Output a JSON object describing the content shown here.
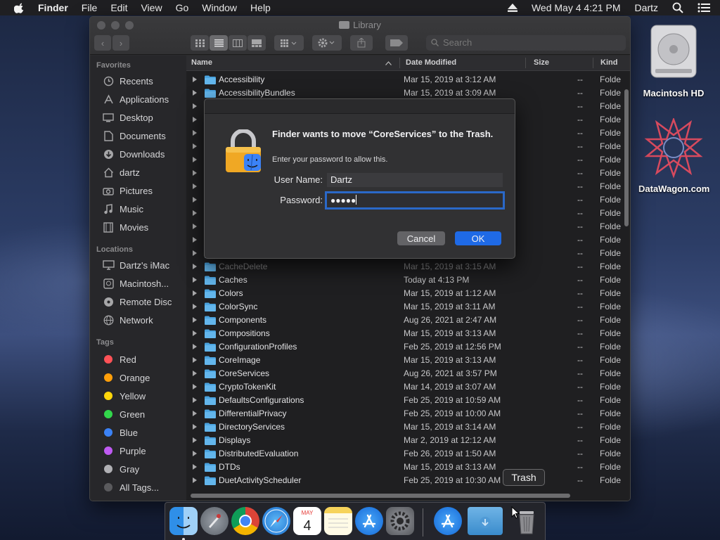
{
  "menubar": {
    "app": "Finder",
    "items": [
      "File",
      "Edit",
      "View",
      "Go",
      "Window",
      "Help"
    ],
    "datetime": "Wed May 4  4:21 PM",
    "user": "Dartz"
  },
  "desktop": {
    "icons": [
      {
        "label": "Macintosh HD",
        "icon": "hard-drive-icon"
      },
      {
        "label": "DataWagon.com",
        "icon": "star-emblem-icon"
      }
    ]
  },
  "window": {
    "title": "Library",
    "search_placeholder": "Search",
    "columns": {
      "name": "Name",
      "date": "Date Modified",
      "size": "Size",
      "kind": "Kind"
    },
    "sidebar": {
      "favorites_heading": "Favorites",
      "favorites": [
        {
          "label": "Recents",
          "icon": "clock-icon"
        },
        {
          "label": "Applications",
          "icon": "applications-icon"
        },
        {
          "label": "Desktop",
          "icon": "desktop-icon"
        },
        {
          "label": "Documents",
          "icon": "document-icon"
        },
        {
          "label": "Downloads",
          "icon": "download-icon"
        },
        {
          "label": "dartz",
          "icon": "home-icon"
        },
        {
          "label": "Pictures",
          "icon": "camera-icon"
        },
        {
          "label": "Music",
          "icon": "music-icon"
        },
        {
          "label": "Movies",
          "icon": "film-icon"
        }
      ],
      "locations_heading": "Locations",
      "locations": [
        {
          "label": "Dartz's iMac",
          "icon": "imac-icon"
        },
        {
          "label": "Macintosh...",
          "icon": "disk-icon"
        },
        {
          "label": "Remote Disc",
          "icon": "disc-icon"
        },
        {
          "label": "Network",
          "icon": "globe-icon"
        }
      ],
      "tags_heading": "Tags",
      "tags": [
        {
          "label": "Red",
          "color": "#ff5257"
        },
        {
          "label": "Orange",
          "color": "#ff9f0a"
        },
        {
          "label": "Yellow",
          "color": "#ffd60a"
        },
        {
          "label": "Green",
          "color": "#32d74b"
        },
        {
          "label": "Blue",
          "color": "#3b82f6"
        },
        {
          "label": "Purple",
          "color": "#bf5af2"
        },
        {
          "label": "Gray",
          "color": "#b0b0b4"
        },
        {
          "label": "All Tags...",
          "color": "#5a5a5d"
        }
      ]
    },
    "rows": [
      {
        "name": "Accessibility",
        "date": "Mar 15, 2019 at 3:12 AM",
        "size": "--",
        "kind": "Folde"
      },
      {
        "name": "AccessibilityBundles",
        "date": "Mar 15, 2019 at 3:09 AM",
        "size": "--",
        "kind": "Folde"
      },
      {
        "name": "",
        "date": "",
        "size": "--",
        "kind": "Folde"
      },
      {
        "name": "",
        "date": "",
        "size": "--",
        "kind": "Folde"
      },
      {
        "name": "",
        "date": "",
        "size": "--",
        "kind": "Folde"
      },
      {
        "name": "",
        "date": "",
        "size": "--",
        "kind": "Folde"
      },
      {
        "name": "",
        "date": "",
        "size": "--",
        "kind": "Folde"
      },
      {
        "name": "",
        "date": "",
        "size": "--",
        "kind": "Folde"
      },
      {
        "name": "",
        "date": "",
        "size": "--",
        "kind": "Folde"
      },
      {
        "name": "",
        "date": "",
        "size": "--",
        "kind": "Folde"
      },
      {
        "name": "",
        "date": "",
        "size": "--",
        "kind": "Folde"
      },
      {
        "name": "",
        "date": "",
        "size": "--",
        "kind": "Folde"
      },
      {
        "name": "",
        "date": "",
        "size": "--",
        "kind": "Folde"
      },
      {
        "name": "",
        "date": "",
        "size": "--",
        "kind": "Folde"
      },
      {
        "name": "CacheDelete",
        "date": "Mar 15, 2019 at 3:15 AM",
        "size": "--",
        "kind": "Folde"
      },
      {
        "name": "Caches",
        "date": "Today at 4:13 PM",
        "size": "--",
        "kind": "Folde"
      },
      {
        "name": "Colors",
        "date": "Mar 15, 2019 at 1:12 AM",
        "size": "--",
        "kind": "Folde"
      },
      {
        "name": "ColorSync",
        "date": "Mar 15, 2019 at 3:11 AM",
        "size": "--",
        "kind": "Folde"
      },
      {
        "name": "Components",
        "date": "Aug 26, 2021 at 2:47 AM",
        "size": "--",
        "kind": "Folde"
      },
      {
        "name": "Compositions",
        "date": "Mar 15, 2019 at 3:13 AM",
        "size": "--",
        "kind": "Folde"
      },
      {
        "name": "ConfigurationProfiles",
        "date": "Feb 25, 2019 at 12:56 PM",
        "size": "--",
        "kind": "Folde"
      },
      {
        "name": "CoreImage",
        "date": "Mar 15, 2019 at 3:13 AM",
        "size": "--",
        "kind": "Folde"
      },
      {
        "name": "CoreServices",
        "date": "Aug 26, 2021 at 3:57 PM",
        "size": "--",
        "kind": "Folde"
      },
      {
        "name": "CryptoTokenKit",
        "date": "Mar 14, 2019 at 3:07 AM",
        "size": "--",
        "kind": "Folde"
      },
      {
        "name": "DefaultsConfigurations",
        "date": "Feb 25, 2019 at 10:59 AM",
        "size": "--",
        "kind": "Folde"
      },
      {
        "name": "DifferentialPrivacy",
        "date": "Feb 25, 2019 at 10:00 AM",
        "size": "--",
        "kind": "Folde"
      },
      {
        "name": "DirectoryServices",
        "date": "Mar 15, 2019 at 3:14 AM",
        "size": "--",
        "kind": "Folde"
      },
      {
        "name": "Displays",
        "date": "Mar 2, 2019 at 12:12 AM",
        "size": "--",
        "kind": "Folde"
      },
      {
        "name": "DistributedEvaluation",
        "date": "Feb 26, 2019 at 1:50 AM",
        "size": "--",
        "kind": "Folde"
      },
      {
        "name": "DTDs",
        "date": "Mar 15, 2019 at 3:13 AM",
        "size": "--",
        "kind": "Folde"
      },
      {
        "name": "DuetActivityScheduler",
        "date": "Feb 25, 2019 at 10:30 AM",
        "size": "--",
        "kind": "Folde"
      }
    ]
  },
  "dialog": {
    "heading": "Finder wants to move “CoreServices” to the Trash.",
    "subtext": "Enter your password to allow this.",
    "username_label": "User Name:",
    "username_value": "Dartz",
    "password_label": "Password:",
    "password_mask": "●●●●●",
    "cancel": "Cancel",
    "ok": "OK"
  },
  "tooltip": "Trash",
  "dock": {
    "apps": [
      {
        "name": "finder-icon"
      },
      {
        "name": "launchpad-icon"
      },
      {
        "name": "chrome-icon"
      },
      {
        "name": "safari-icon"
      },
      {
        "name": "calendar-icon",
        "text": "4",
        "month": "MAY"
      },
      {
        "name": "notes-icon"
      },
      {
        "name": "app-store-icon"
      },
      {
        "name": "system-preferences-icon"
      },
      {
        "name": "app-store-icon-2"
      },
      {
        "name": "downloads-folder-icon"
      },
      {
        "name": "trash-icon"
      }
    ]
  }
}
